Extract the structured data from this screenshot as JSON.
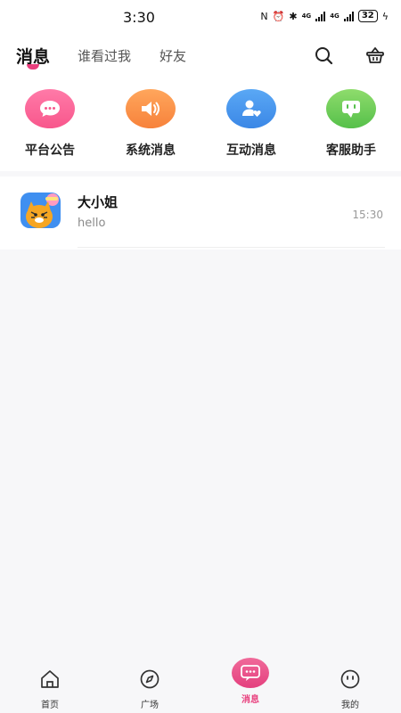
{
  "status_bar": {
    "time": "3:30",
    "network_1": "4G",
    "network_2": "4G",
    "battery": "32"
  },
  "header": {
    "tabs": [
      "消息",
      "谁看过我",
      "好友"
    ],
    "active_tab": "消息",
    "accent_color": "#e83f7d",
    "icons": [
      "search-icon",
      "basket-icon"
    ]
  },
  "shortcuts": [
    {
      "label": "平台公告",
      "icon": "chat-bubble-icon",
      "color_from": "#ff7aa8",
      "color_to": "#f8578c"
    },
    {
      "label": "系统消息",
      "icon": "speaker-icon",
      "color_from": "#ffa65c",
      "color_to": "#f7823b"
    },
    {
      "label": "互动消息",
      "icon": "user-heart-icon",
      "color_from": "#5aa8f5",
      "color_to": "#3b87e6"
    },
    {
      "label": "客服助手",
      "icon": "support-chat-icon",
      "color_from": "#8edc6c",
      "color_to": "#56c04a"
    }
  ],
  "conversations": [
    {
      "name": "大小姐",
      "last_message": "hello",
      "time": "15:30",
      "avatar": "tiger-avatar"
    }
  ],
  "tabbar": {
    "items": [
      {
        "label": "首页",
        "icon": "home-icon"
      },
      {
        "label": "广场",
        "icon": "compass-icon"
      },
      {
        "label": "消息",
        "icon": "message-icon"
      },
      {
        "label": "我的",
        "icon": "face-icon"
      }
    ],
    "active": "消息"
  }
}
